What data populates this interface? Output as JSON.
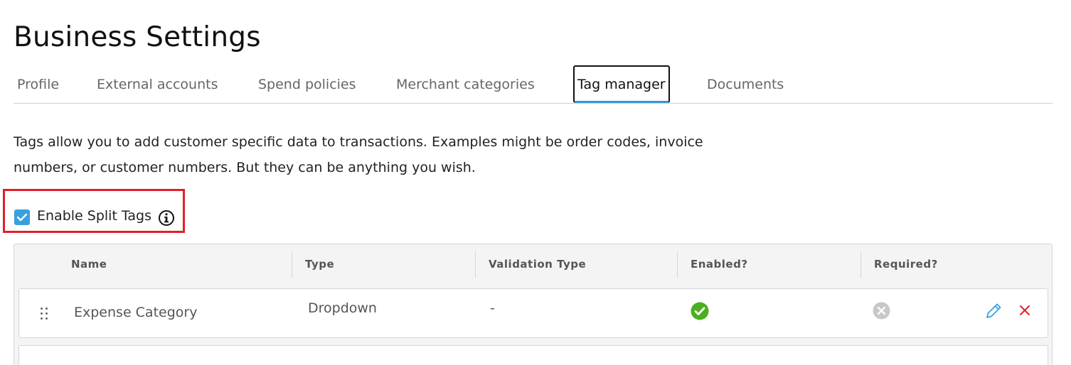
{
  "page": {
    "title": "Business Settings"
  },
  "tabs": [
    {
      "label": "Profile"
    },
    {
      "label": "External accounts"
    },
    {
      "label": "Spend policies"
    },
    {
      "label": "Merchant categories"
    },
    {
      "label": "Tag manager",
      "active": true
    },
    {
      "label": "Documents"
    }
  ],
  "description": "Tags allow you to add customer specific data to transactions. Examples might be order codes, invoice numbers, or customer numbers. But they can be anything you wish.",
  "split_tags": {
    "label": "Enable Split Tags",
    "checked": true,
    "icon": "info-icon"
  },
  "table": {
    "columns": [
      "Name",
      "Type",
      "Validation Type",
      "Enabled?",
      "Required?"
    ],
    "rows": [
      {
        "name": "Expense Category",
        "type": "Dropdown",
        "validation_type": "-",
        "enabled": true,
        "required": false
      }
    ]
  },
  "colors": {
    "accent": "#3aa0dd",
    "highlight": "#e0202a",
    "enabled": "#4caf1f",
    "disabled": "#c8c8c8",
    "delete": "#e0202a"
  }
}
